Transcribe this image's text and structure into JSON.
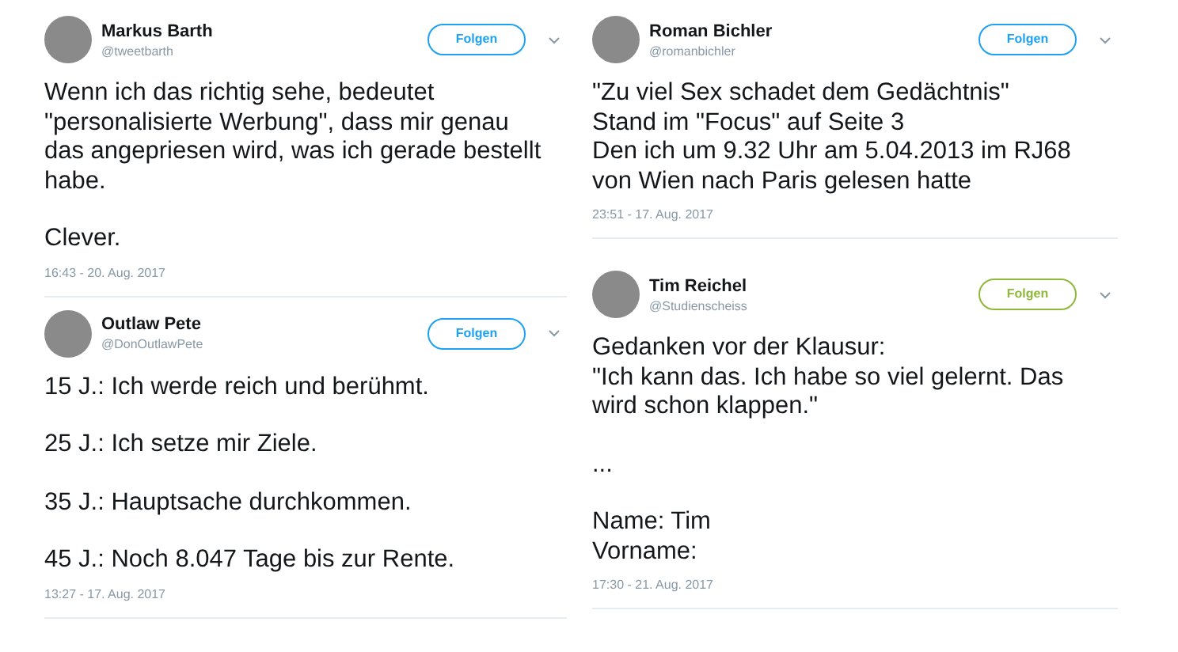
{
  "columns": [
    {
      "tweets": [
        {
          "name": "Markus Barth",
          "handle": "@tweetbarth",
          "follow": "Folgen",
          "color": "#1da1f2",
          "paragraphs": [
            [
              "Wenn ich das richtig sehe, bedeutet",
              "\"personalisierte Werbung\", dass mir genau",
              "das angepriesen wird, was ich gerade bestellt",
              "habe."
            ],
            [
              "Clever."
            ]
          ],
          "time": "16:43 - 20. Aug. 2017"
        },
        {
          "name": "Outlaw Pete",
          "handle": "@DonOutlawPete",
          "follow": "Folgen",
          "color": "#1da1f2",
          "paragraphs": [
            [
              "15 J.: Ich werde reich und berühmt."
            ],
            [
              "25 J.: Ich setze mir Ziele."
            ],
            [
              "35 J.: Hauptsache durchkommen."
            ],
            [
              "45 J.: Noch 8.047 Tage bis zur Rente."
            ]
          ],
          "time": "13:27 - 17. Aug. 2017"
        }
      ]
    },
    {
      "tweets": [
        {
          "name": "Roman Bichler",
          "handle": "@romanbichler",
          "follow": "Folgen",
          "color": "#1da1f2",
          "paragraphs": [
            [
              "\"Zu viel Sex schadet dem Gedächtnis\"",
              "Stand im \"Focus\" auf Seite 3",
              "Den ich um 9.32 Uhr am 5.04.2013 im RJ68",
              "von Wien nach Paris gelesen hatte"
            ]
          ],
          "time": "23:51 - 17. Aug. 2017"
        },
        {
          "name": "Tim Reichel",
          "handle": "@Studienscheiss",
          "follow": "Folgen",
          "color": "#8fb83a",
          "paragraphs": [
            [
              "Gedanken vor der Klausur:",
              "\"Ich kann das. Ich habe so viel gelernt. Das",
              "wird schon klappen.\""
            ],
            [
              "..."
            ],
            [
              "Name: Tim",
              "Vorname:"
            ]
          ],
          "time": "17:30 - 21. Aug. 2017"
        }
      ]
    }
  ]
}
